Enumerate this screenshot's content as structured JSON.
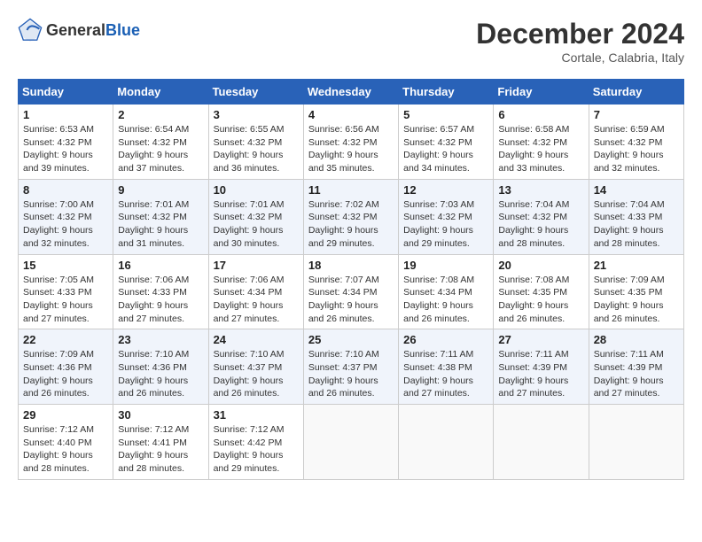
{
  "header": {
    "logo_general": "General",
    "logo_blue": "Blue",
    "month_title": "December 2024",
    "location": "Cortale, Calabria, Italy"
  },
  "days_of_week": [
    "Sunday",
    "Monday",
    "Tuesday",
    "Wednesday",
    "Thursday",
    "Friday",
    "Saturday"
  ],
  "weeks": [
    [
      {
        "day": "1",
        "sunrise": "6:53 AM",
        "sunset": "4:32 PM",
        "daylight": "9 hours and 39 minutes."
      },
      {
        "day": "2",
        "sunrise": "6:54 AM",
        "sunset": "4:32 PM",
        "daylight": "9 hours and 37 minutes."
      },
      {
        "day": "3",
        "sunrise": "6:55 AM",
        "sunset": "4:32 PM",
        "daylight": "9 hours and 36 minutes."
      },
      {
        "day": "4",
        "sunrise": "6:56 AM",
        "sunset": "4:32 PM",
        "daylight": "9 hours and 35 minutes."
      },
      {
        "day": "5",
        "sunrise": "6:57 AM",
        "sunset": "4:32 PM",
        "daylight": "9 hours and 34 minutes."
      },
      {
        "day": "6",
        "sunrise": "6:58 AM",
        "sunset": "4:32 PM",
        "daylight": "9 hours and 33 minutes."
      },
      {
        "day": "7",
        "sunrise": "6:59 AM",
        "sunset": "4:32 PM",
        "daylight": "9 hours and 32 minutes."
      }
    ],
    [
      {
        "day": "8",
        "sunrise": "7:00 AM",
        "sunset": "4:32 PM",
        "daylight": "9 hours and 32 minutes."
      },
      {
        "day": "9",
        "sunrise": "7:01 AM",
        "sunset": "4:32 PM",
        "daylight": "9 hours and 31 minutes."
      },
      {
        "day": "10",
        "sunrise": "7:01 AM",
        "sunset": "4:32 PM",
        "daylight": "9 hours and 30 minutes."
      },
      {
        "day": "11",
        "sunrise": "7:02 AM",
        "sunset": "4:32 PM",
        "daylight": "9 hours and 29 minutes."
      },
      {
        "day": "12",
        "sunrise": "7:03 AM",
        "sunset": "4:32 PM",
        "daylight": "9 hours and 29 minutes."
      },
      {
        "day": "13",
        "sunrise": "7:04 AM",
        "sunset": "4:32 PM",
        "daylight": "9 hours and 28 minutes."
      },
      {
        "day": "14",
        "sunrise": "7:04 AM",
        "sunset": "4:33 PM",
        "daylight": "9 hours and 28 minutes."
      }
    ],
    [
      {
        "day": "15",
        "sunrise": "7:05 AM",
        "sunset": "4:33 PM",
        "daylight": "9 hours and 27 minutes."
      },
      {
        "day": "16",
        "sunrise": "7:06 AM",
        "sunset": "4:33 PM",
        "daylight": "9 hours and 27 minutes."
      },
      {
        "day": "17",
        "sunrise": "7:06 AM",
        "sunset": "4:34 PM",
        "daylight": "9 hours and 27 minutes."
      },
      {
        "day": "18",
        "sunrise": "7:07 AM",
        "sunset": "4:34 PM",
        "daylight": "9 hours and 26 minutes."
      },
      {
        "day": "19",
        "sunrise": "7:08 AM",
        "sunset": "4:34 PM",
        "daylight": "9 hours and 26 minutes."
      },
      {
        "day": "20",
        "sunrise": "7:08 AM",
        "sunset": "4:35 PM",
        "daylight": "9 hours and 26 minutes."
      },
      {
        "day": "21",
        "sunrise": "7:09 AM",
        "sunset": "4:35 PM",
        "daylight": "9 hours and 26 minutes."
      }
    ],
    [
      {
        "day": "22",
        "sunrise": "7:09 AM",
        "sunset": "4:36 PM",
        "daylight": "9 hours and 26 minutes."
      },
      {
        "day": "23",
        "sunrise": "7:10 AM",
        "sunset": "4:36 PM",
        "daylight": "9 hours and 26 minutes."
      },
      {
        "day": "24",
        "sunrise": "7:10 AM",
        "sunset": "4:37 PM",
        "daylight": "9 hours and 26 minutes."
      },
      {
        "day": "25",
        "sunrise": "7:10 AM",
        "sunset": "4:37 PM",
        "daylight": "9 hours and 26 minutes."
      },
      {
        "day": "26",
        "sunrise": "7:11 AM",
        "sunset": "4:38 PM",
        "daylight": "9 hours and 27 minutes."
      },
      {
        "day": "27",
        "sunrise": "7:11 AM",
        "sunset": "4:39 PM",
        "daylight": "9 hours and 27 minutes."
      },
      {
        "day": "28",
        "sunrise": "7:11 AM",
        "sunset": "4:39 PM",
        "daylight": "9 hours and 27 minutes."
      }
    ],
    [
      {
        "day": "29",
        "sunrise": "7:12 AM",
        "sunset": "4:40 PM",
        "daylight": "9 hours and 28 minutes."
      },
      {
        "day": "30",
        "sunrise": "7:12 AM",
        "sunset": "4:41 PM",
        "daylight": "9 hours and 28 minutes."
      },
      {
        "day": "31",
        "sunrise": "7:12 AM",
        "sunset": "4:42 PM",
        "daylight": "9 hours and 29 minutes."
      },
      null,
      null,
      null,
      null
    ]
  ],
  "labels": {
    "sunrise": "Sunrise:",
    "sunset": "Sunset:",
    "daylight": "Daylight:"
  }
}
